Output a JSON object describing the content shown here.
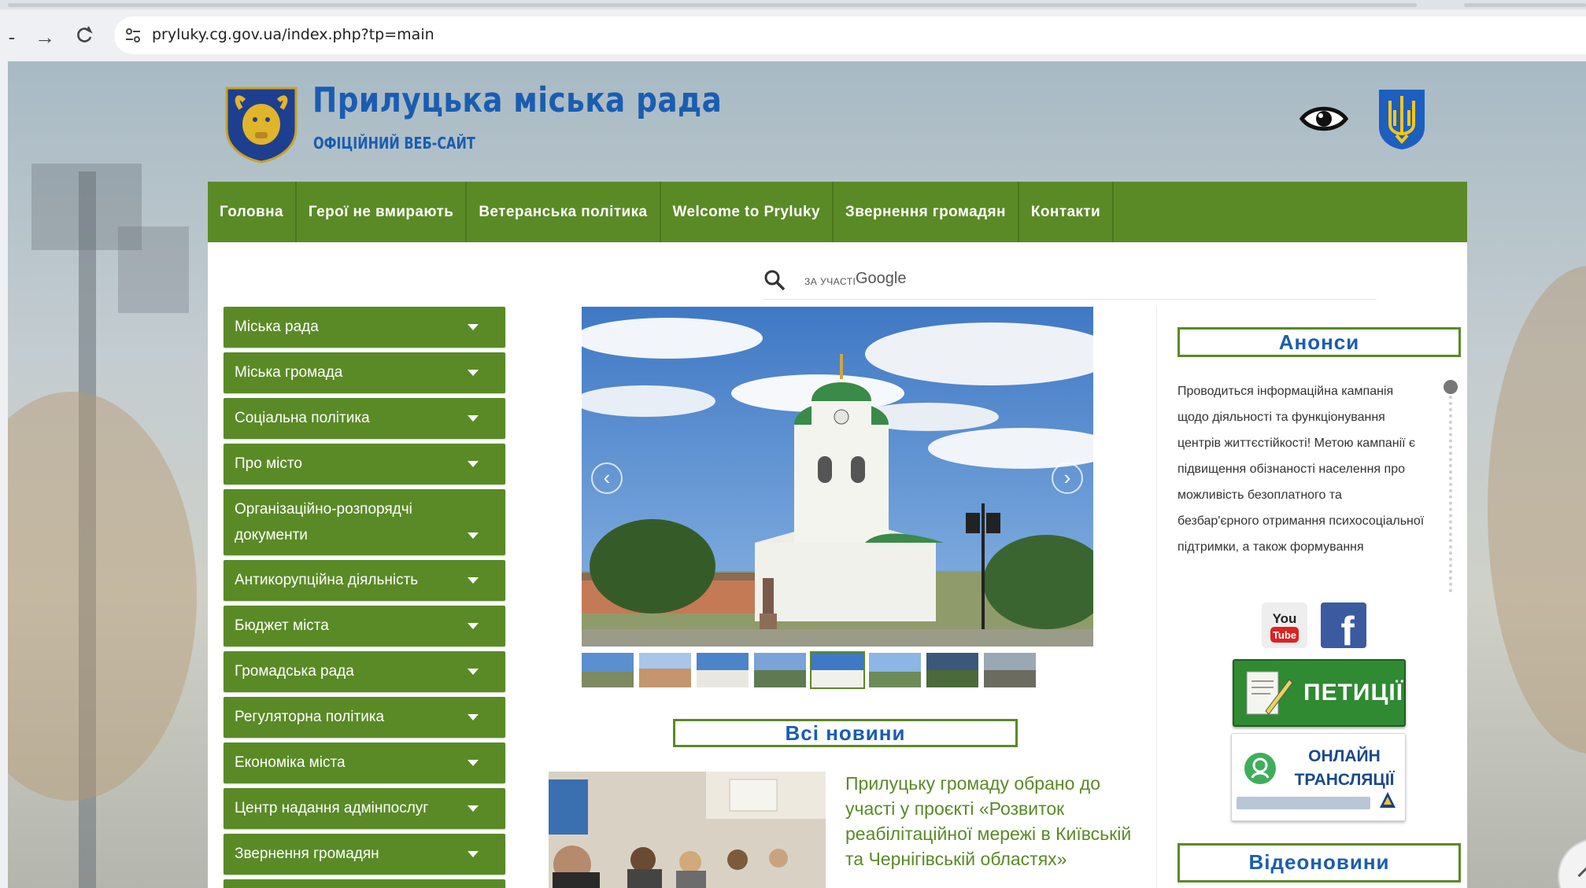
{
  "browser": {
    "url": "pryluky.cg.gov.ua/index.php?tp=main",
    "back_icon": "-",
    "forward_icon": "→",
    "reload_icon": "C"
  },
  "header": {
    "title": "Прилуцька міська рада",
    "subtitle": "ОФІЦІЙНИЙ ВЕБ-САЙТ"
  },
  "nav": {
    "items": [
      {
        "label": "Головна"
      },
      {
        "label": "Герої не вмирають"
      },
      {
        "label": "Ветеранська політика"
      },
      {
        "label": "Welcome to Pryluky"
      },
      {
        "label": "Звернення громадян"
      },
      {
        "label": "Контакти"
      }
    ]
  },
  "search": {
    "powered_by": "ЗА УЧАСТІ",
    "brand": "Google"
  },
  "sidebar": {
    "items": [
      {
        "label": "Міська рада"
      },
      {
        "label": "Міська громада"
      },
      {
        "label": "Соціальна політика"
      },
      {
        "label": "Про місто"
      },
      {
        "label": "Організаційно-розпорядчі документи"
      },
      {
        "label": "Антикорупційна діяльність"
      },
      {
        "label": "Бюджет міста"
      },
      {
        "label": "Громадська рада"
      },
      {
        "label": "Регуляторна політика"
      },
      {
        "label": "Економіка міста"
      },
      {
        "label": "Центр надання адмінпослуг"
      },
      {
        "label": "Звернення громадян"
      }
    ]
  },
  "slider": {
    "prev": "‹",
    "next": "›",
    "active_thumb": 4
  },
  "news": {
    "section_title": "Всі новини",
    "item_title": "Прилуцьку громаду обрано до участі у проєкті «Розвиток реабілітаційної мережі в Київській та Чернігівській областях»"
  },
  "announcements": {
    "section_title": "Анонси",
    "text": "Проводиться інформаційна кампанія щодо діяльності та функціонування центрів життєстійкості! Метою кампанії є підвищення обізнаності населення про можливість безоплатного та безбар'єрного отримання психосоціальної підтримки, а також формування"
  },
  "social": {
    "youtube_top": "You",
    "youtube_bottom": "Tube",
    "facebook": "f"
  },
  "banners": {
    "petitions": "ПЕТИЦІЇ",
    "online": "ОНЛАЙН ТРАНСЛЯЦІЇ"
  },
  "video": {
    "section_title": "Відеоновини"
  },
  "colors": {
    "primary_green": "#5a8a26",
    "title_blue": "#1a5db0"
  }
}
